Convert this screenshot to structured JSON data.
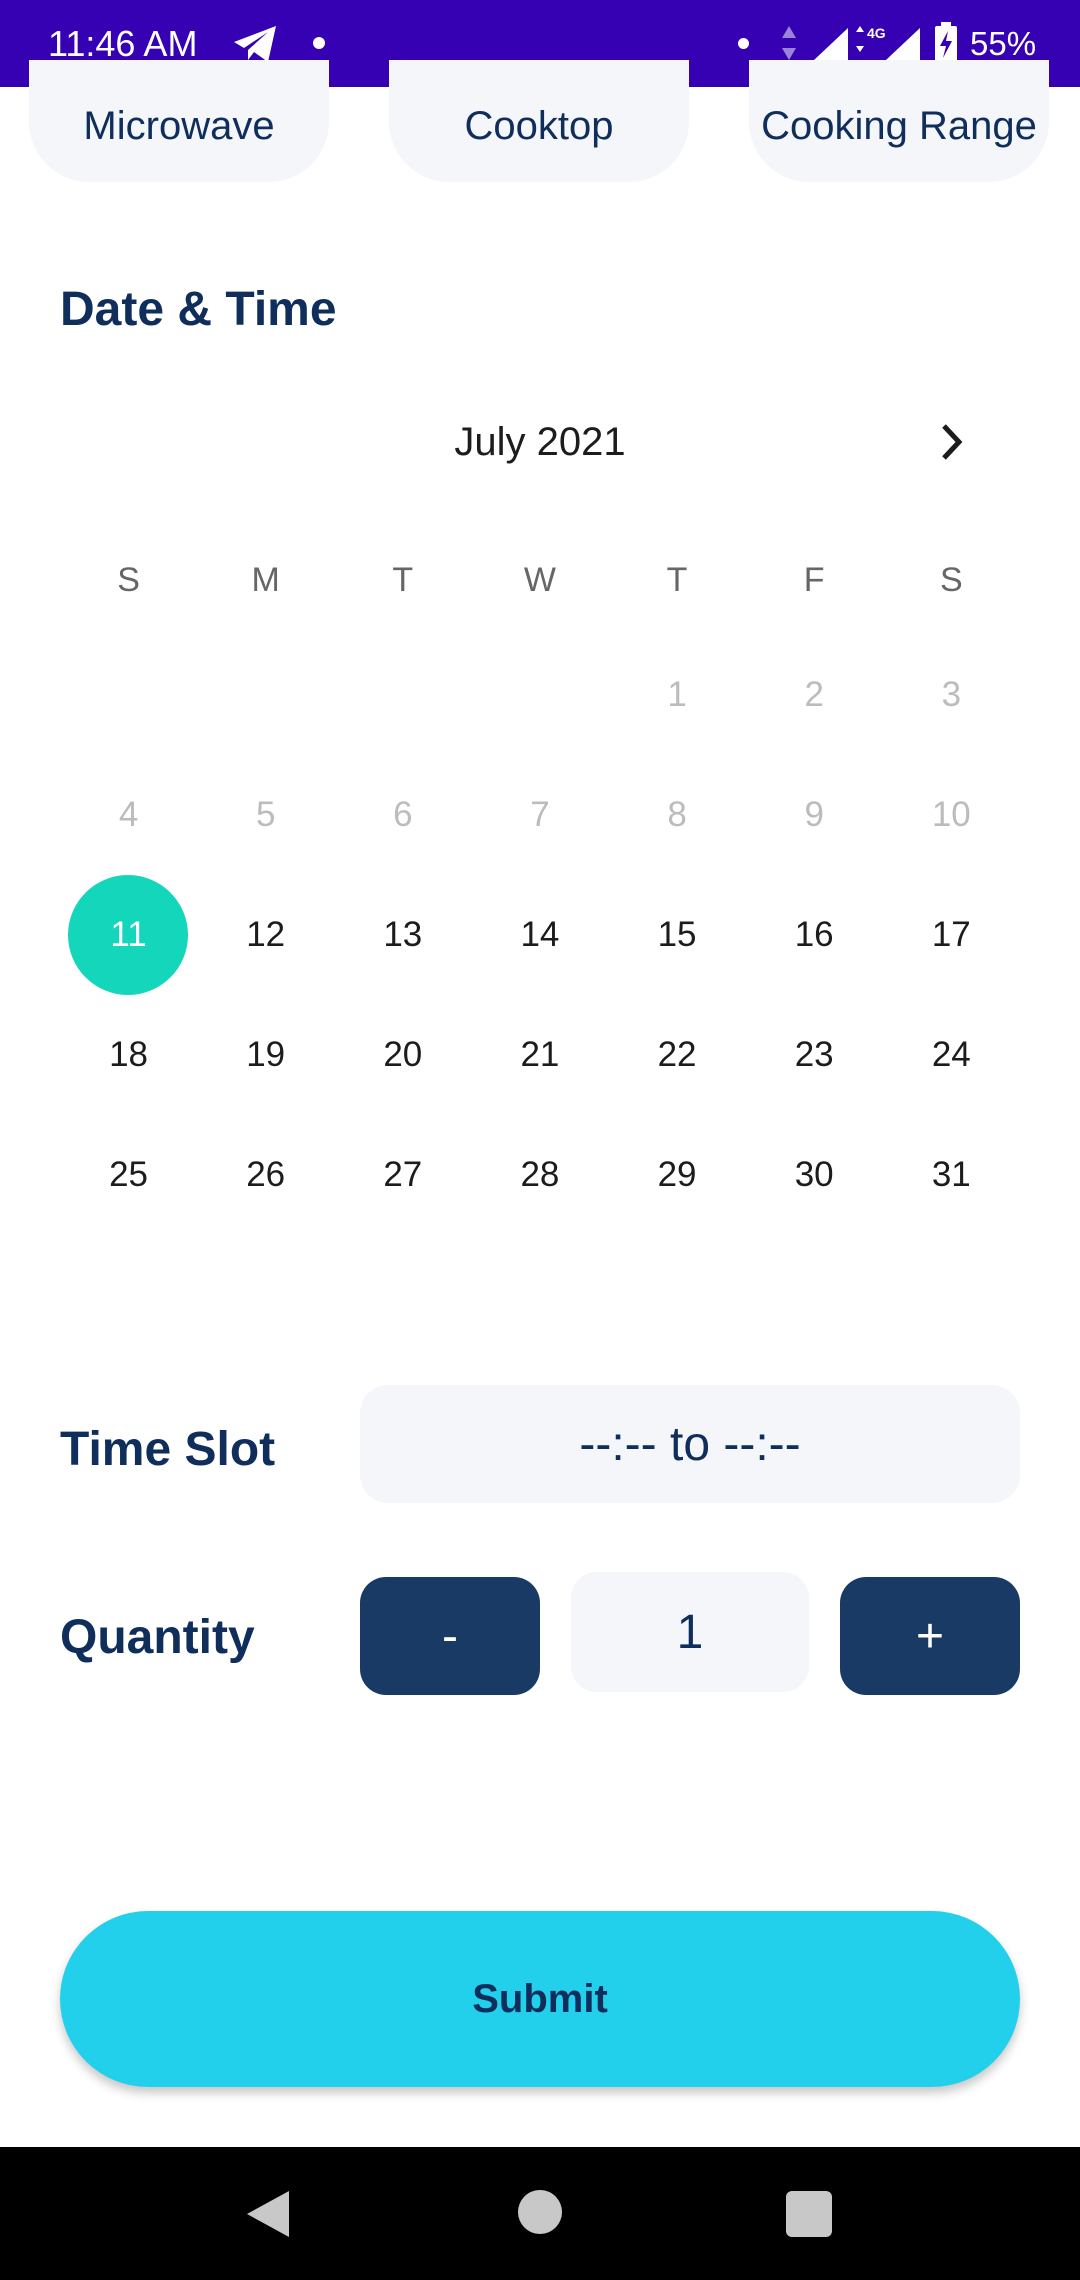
{
  "status_bar": {
    "time": "11:46 AM",
    "network": "4G",
    "battery": "55%"
  },
  "categories": [
    "Microwave",
    "Cooktop",
    "Cooking Range"
  ],
  "date_section": {
    "title": "Date & Time"
  },
  "calendar": {
    "month_label": "July 2021",
    "weekdays": [
      "S",
      "M",
      "T",
      "W",
      "T",
      "F",
      "S"
    ],
    "weeks": [
      [
        "",
        "",
        "",
        "",
        "1",
        "2",
        "3"
      ],
      [
        "4",
        "5",
        "6",
        "7",
        "8",
        "9",
        "10"
      ],
      [
        "11",
        "12",
        "13",
        "14",
        "15",
        "16",
        "17"
      ],
      [
        "18",
        "19",
        "20",
        "21",
        "22",
        "23",
        "24"
      ],
      [
        "25",
        "26",
        "27",
        "28",
        "29",
        "30",
        "31"
      ]
    ],
    "selected_day": "11",
    "disabled_before": "11"
  },
  "time_slot": {
    "label": "Time Slot",
    "value": "--:-- to --:--"
  },
  "quantity": {
    "label": "Quantity",
    "minus": "-",
    "value": "1",
    "plus": "+"
  },
  "submit": {
    "label": "Submit"
  },
  "colors": {
    "status_bar": "#3600b3",
    "heading": "#0f2e5c",
    "selected_day": "#14d6bb",
    "submit": "#22d0ec",
    "qty_button": "#1a3a66"
  }
}
